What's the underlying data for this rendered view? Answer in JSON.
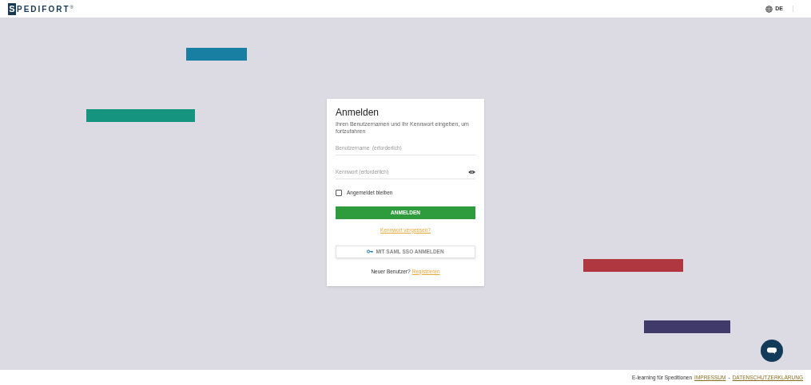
{
  "header": {
    "logo_mark": "S",
    "logo_text": "PEDIFORT",
    "logo_sup": "®",
    "language": "DE"
  },
  "login": {
    "title": "Anmelden",
    "subtitle": "Ihren Benutzernamen und Ihr Kennwort eingeben, um fortzufahren",
    "username": {
      "placeholder": "Benutzername  (erforderlich)"
    },
    "password": {
      "placeholder": "Kennwort (erforderlich)"
    },
    "remember": {
      "label": "Angemeldet bleiben",
      "checked": false
    },
    "submit": "ANMELDEN",
    "forgot": "Kennwort vergessen?",
    "sso": "MIT SAML SSO ANMELDEN",
    "new_user": "Neuer Benutzer?",
    "register": "Registrieren"
  },
  "footer": {
    "text": "E-learning für Speditionen",
    "links": [
      "IMPRESSUM",
      "DATENSCHUTZERKLÄRUNG"
    ],
    "separator": "-"
  }
}
